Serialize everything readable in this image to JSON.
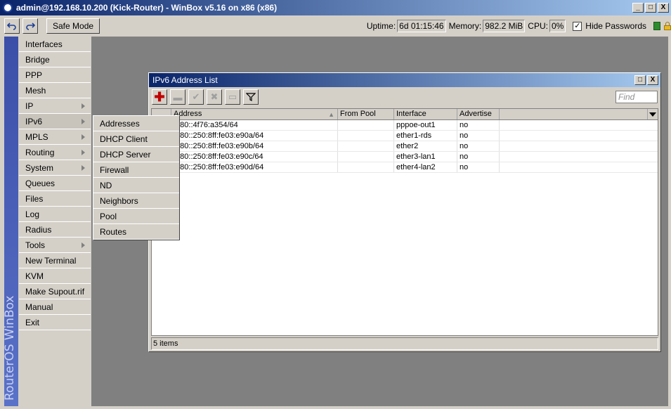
{
  "window": {
    "title": "admin@192.168.10.200 (Kick-Router) - WinBox v5.16 on x86 (x86)",
    "min": "_",
    "max": "□",
    "close": "X"
  },
  "toolbar": {
    "undo_icon": "undo-icon",
    "redo_icon": "redo-icon",
    "safe_mode": "Safe Mode",
    "uptime_label": "Uptime:",
    "uptime_value": "6d 01:15:46",
    "memory_label": "Memory:",
    "memory_value": "982.2 MiB",
    "cpu_label": "CPU:",
    "cpu_value": "0%",
    "hide_passwords": "Hide Passwords",
    "hide_passwords_checked": "✓"
  },
  "brand": "RouterOS WinBox",
  "menu": [
    {
      "label": "Interfaces"
    },
    {
      "label": "Bridge"
    },
    {
      "label": "PPP"
    },
    {
      "label": "Mesh"
    },
    {
      "label": "IP"
    },
    {
      "label": "IPv6"
    },
    {
      "label": "MPLS"
    },
    {
      "label": "Routing"
    },
    {
      "label": "System"
    },
    {
      "label": "Queues"
    },
    {
      "label": "Files"
    },
    {
      "label": "Log"
    },
    {
      "label": "Radius"
    },
    {
      "label": "Tools"
    },
    {
      "label": "New Terminal"
    },
    {
      "label": "KVM"
    },
    {
      "label": "Make Supout.rif"
    },
    {
      "label": "Manual"
    },
    {
      "label": "Exit"
    }
  ],
  "submenu": [
    "Addresses",
    "DHCP Client",
    "DHCP Server",
    "Firewall",
    "ND",
    "Neighbors",
    "Pool",
    "Routes"
  ],
  "list_window": {
    "title": "IPv6 Address List",
    "find_placeholder": "Find",
    "columns": [
      "Address",
      "From Pool",
      "Interface",
      "Advertise"
    ],
    "rows": [
      [
        "fe80::4f76:a354/64",
        "",
        "pppoe-out1",
        "no"
      ],
      [
        "fe80::250:8ff:fe03:e90a/64",
        "",
        "ether1-rds",
        "no"
      ],
      [
        "fe80::250:8ff:fe03:e90b/64",
        "",
        "ether2",
        "no"
      ],
      [
        "fe80::250:8ff:fe03:e90c/64",
        "",
        "ether3-lan1",
        "no"
      ],
      [
        "fe80::250:8ff:fe03:e90d/64",
        "",
        "ether4-lan2",
        "no"
      ]
    ],
    "status": "5 items"
  }
}
